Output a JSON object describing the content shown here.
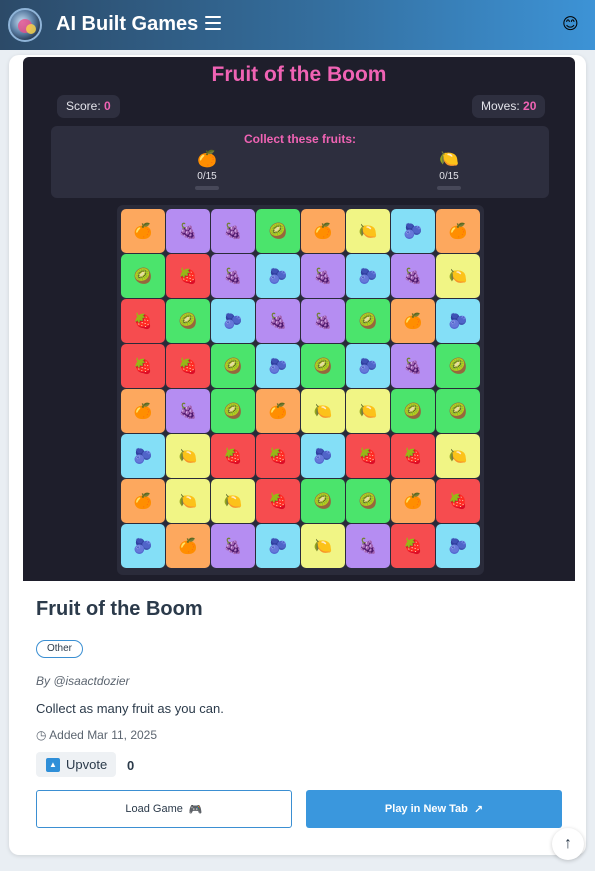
{
  "header": {
    "site_title": "AI Built Games",
    "menu_icon": "hamburger-icon",
    "user_icon": "😊"
  },
  "game": {
    "title": "Fruit of the Boom",
    "score_label": "Score:",
    "score": "0",
    "moves_label": "Moves:",
    "moves": "20",
    "collect_title": "Collect these fruits:",
    "targets": [
      {
        "fruit": "orange",
        "emoji": "🍊",
        "count": "0/15",
        "progress": 0
      },
      {
        "fruit": "lemon",
        "emoji": "🍋",
        "count": "0/15",
        "progress": 0
      }
    ],
    "fruit_styles": {
      "orange": {
        "emoji": "🍊",
        "color": "#fda85e"
      },
      "grape": {
        "emoji": "🍇",
        "color": "#b58df2"
      },
      "kiwi": {
        "emoji": "🥝",
        "color": "#4be46c"
      },
      "lemon": {
        "emoji": "🍋",
        "color": "#f1f585"
      },
      "berry": {
        "emoji": "🫐",
        "color": "#84dff7"
      },
      "strawberry": {
        "emoji": "🍓",
        "color": "#f64c4f"
      }
    },
    "board": [
      [
        "orange",
        "grape",
        "grape",
        "kiwi",
        "orange",
        "lemon",
        "berry",
        "orange"
      ],
      [
        "kiwi",
        "strawberry",
        "grape",
        "berry",
        "grape",
        "berry",
        "grape",
        "lemon"
      ],
      [
        "strawberry",
        "kiwi",
        "berry",
        "grape",
        "grape",
        "kiwi",
        "orange",
        "berry"
      ],
      [
        "strawberry",
        "strawberry",
        "kiwi",
        "berry",
        "kiwi",
        "berry",
        "grape",
        "kiwi"
      ],
      [
        "orange",
        "grape",
        "kiwi",
        "orange",
        "lemon",
        "lemon",
        "kiwi",
        "kiwi"
      ],
      [
        "berry",
        "lemon",
        "strawberry",
        "strawberry",
        "berry",
        "strawberry",
        "strawberry",
        "lemon"
      ],
      [
        "orange",
        "lemon",
        "lemon",
        "strawberry",
        "kiwi",
        "kiwi",
        "orange",
        "strawberry"
      ],
      [
        "berry",
        "orange",
        "grape",
        "berry",
        "lemon",
        "grape",
        "strawberry",
        "berry"
      ]
    ]
  },
  "details": {
    "title": "Fruit of the Boom",
    "category": "Other",
    "author": "By @isaactdozier",
    "description": "Collect as many fruit as you can.",
    "added": "Added Mar 11, 2025",
    "upvote_label": "Upvote",
    "votes": "0",
    "load_label": "Load Game",
    "load_icon": "🎮",
    "play_label": "Play in New Tab",
    "play_icon": "↗"
  },
  "colors": {
    "accent": "#3a97dd",
    "game_bg": "#1e1e2b",
    "pink": "#f063b4"
  }
}
